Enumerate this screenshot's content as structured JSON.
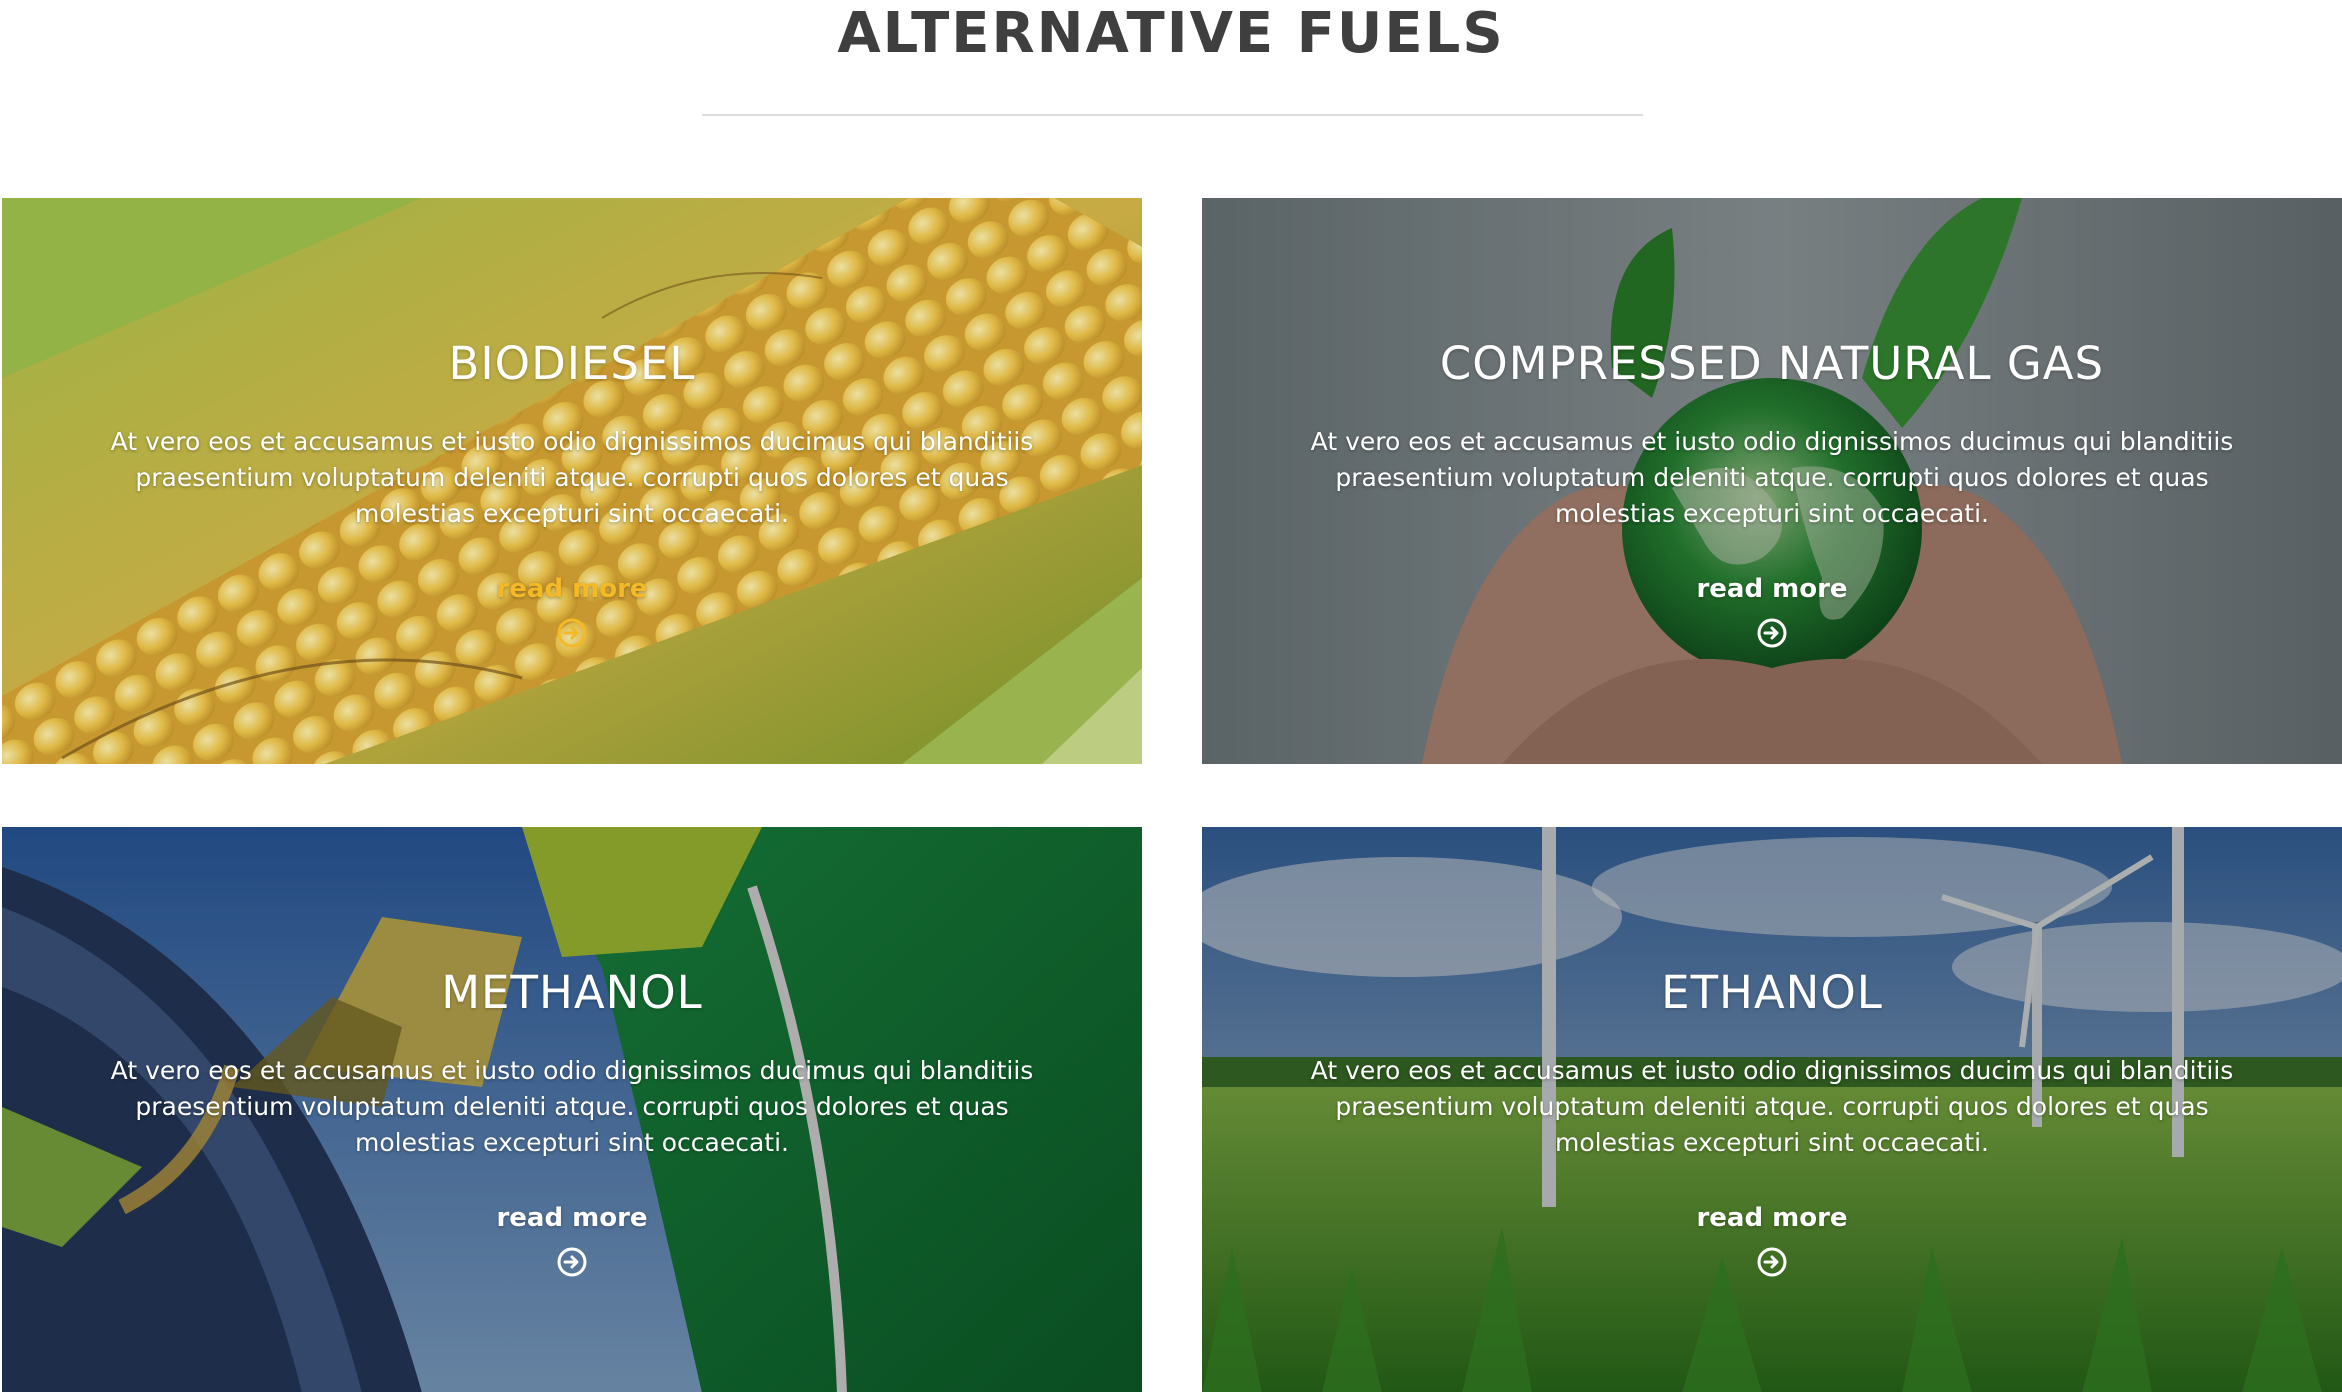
{
  "section": {
    "title": "ALTERNATIVE FUELS"
  },
  "cards": [
    {
      "title": "BIODIESEL",
      "text": "At vero eos et accusamus et iusto odio dignissimos ducimus qui blanditiis praesentium voluptatum deleniti atque. corrupti quos dolores et quas molestias excepturi sint occaecati.",
      "link_label": "read more",
      "link_color": "#f4b927",
      "icon": "arrow-circle-right-icon",
      "image": "corn cob"
    },
    {
      "title": "COMPRESSED NATURAL GAS",
      "text": "At vero eos et accusamus et iusto odio dignissimos ducimus qui blanditiis praesentium voluptatum deleniti atque. corrupti quos dolores et quas molestias excepturi sint occaecati.",
      "link_label": "read more",
      "link_color": "#ffffff",
      "icon": "arrow-circle-right-icon",
      "image": "hands holding green globe"
    },
    {
      "title": "METHANOL",
      "text": "At vero eos et accusamus et iusto odio dignissimos ducimus qui blanditiis praesentium voluptatum deleniti atque. corrupti quos dolores et quas molestias excepturi sint occaecati.",
      "link_label": "read more",
      "link_color": "#ffffff",
      "icon": "arrow-circle-right-icon",
      "image": "pouring oil into car"
    },
    {
      "title": "ETHANOL",
      "text": "At vero eos et accusamus et iusto odio dignissimos ducimus qui blanditiis praesentium voluptatum deleniti atque. corrupti quos dolores et quas molestias excepturi sint occaecati.",
      "link_label": "read more",
      "link_color": "#ffffff",
      "icon": "arrow-circle-right-icon",
      "image": "wind turbines over green field"
    }
  ]
}
